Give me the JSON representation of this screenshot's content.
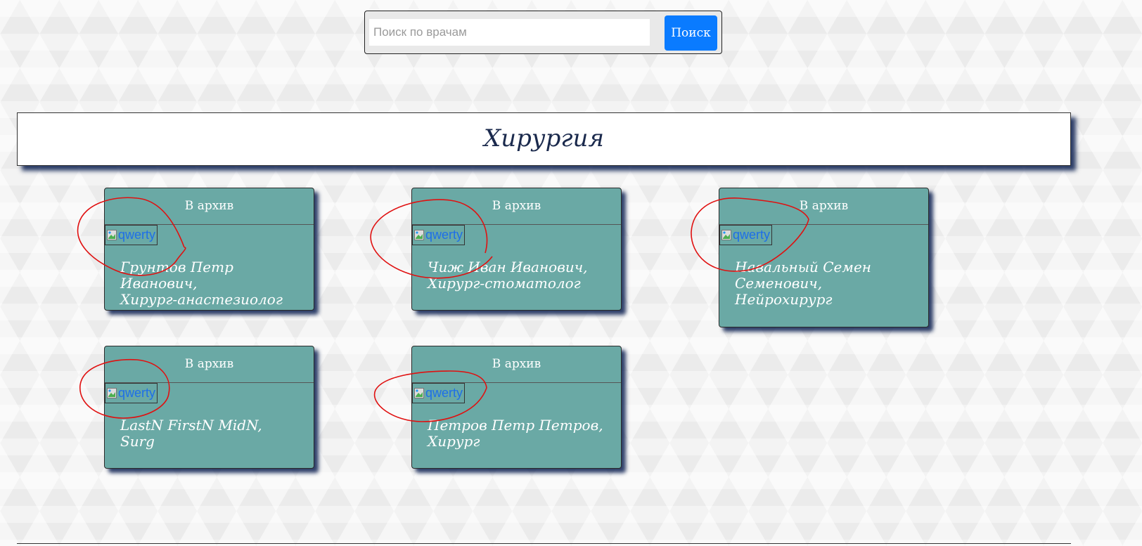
{
  "search": {
    "placeholder": "Поиск по врачам",
    "value": "",
    "button_label": "Поиск"
  },
  "section": {
    "title": "Хирургия"
  },
  "doctors": [
    {
      "archive_label": "В архив",
      "image_alt": "qwerty",
      "name": "Грунтов Петр Иванович,",
      "specialty": "Хирург-анастезиолог"
    },
    {
      "archive_label": "В архив",
      "image_alt": "qwerty",
      "name": "Чиж Иван Иванович,",
      "specialty": "Хирург-стоматолог"
    },
    {
      "archive_label": "В архив",
      "image_alt": "qwerty",
      "name": "Навальный Семен Семенович,",
      "specialty": "Нейрохирург"
    },
    {
      "archive_label": "В архив",
      "image_alt": "qwerty",
      "name": "LastN FirstN MidN,",
      "specialty": "Surg"
    },
    {
      "archive_label": "В архив",
      "image_alt": "qwerty",
      "name": "Петров Петр Петров,",
      "specialty": "Хирург"
    }
  ],
  "colors": {
    "card_background": "#6aa9a5",
    "search_button": "#0a7bff",
    "annotation": "#e01010",
    "title_text": "#1b2a4d"
  },
  "icons": {
    "image_placeholder": "broken-image-icon"
  }
}
